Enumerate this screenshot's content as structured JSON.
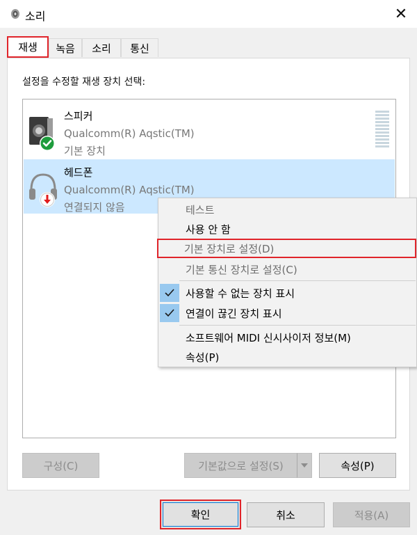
{
  "window": {
    "title": "소리",
    "close_glyph": "✕"
  },
  "tabs": [
    {
      "label": "재생",
      "active": true
    },
    {
      "label": "녹음"
    },
    {
      "label": "소리"
    },
    {
      "label": "통신"
    }
  ],
  "instruction": "설정을 수정할 재생 장치 선택:",
  "devices": [
    {
      "name": "스피커",
      "description": "Qualcomm(R) Aqstic(TM)",
      "status": "기본 장치",
      "icon": "speaker-icon",
      "badge": "default-check-badge",
      "badge_color": "#1e9c3c",
      "selected": false
    },
    {
      "name": "헤드폰",
      "description": "Qualcomm(R) Aqstic(TM)",
      "status": "연결되지 않음",
      "icon": "headphones-icon",
      "badge": "disconnected-badge",
      "badge_color": "#e21b1b",
      "selected": true
    }
  ],
  "context_menu": {
    "items": [
      {
        "label": "테스트",
        "enabled": false
      },
      {
        "label": "사용 안 함",
        "enabled": true
      },
      {
        "label": "기본 장치로 설정(D)",
        "enabled": false,
        "highlighted": true
      },
      {
        "label": "기본 통신 장치로 설정(C)",
        "enabled": false
      },
      {
        "label": "사용할 수 없는 장치 표시",
        "enabled": true,
        "checked": true
      },
      {
        "label": "연결이 끊긴 장치 표시",
        "enabled": true,
        "checked": true
      },
      {
        "label": "소프트웨어 MIDI 신시사이저 정보(M)",
        "enabled": true
      },
      {
        "label": "속성(P)",
        "enabled": true
      }
    ]
  },
  "panel_buttons": {
    "configure": "구성(C)",
    "set_default": "기본값으로 설정(S)",
    "properties": "속성(P)"
  },
  "dialog_buttons": {
    "ok": "확인",
    "cancel": "취소",
    "apply": "적용(A)"
  },
  "colors": {
    "selection": "#cce8ff",
    "highlight_border": "#e0242a",
    "check_bg": "#99c9ef"
  }
}
